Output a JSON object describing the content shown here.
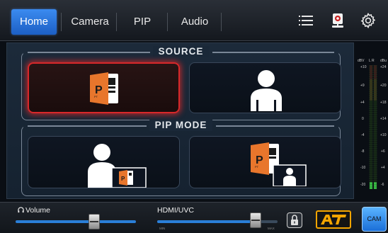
{
  "tabs": [
    {
      "label": "Home",
      "active": true
    },
    {
      "label": "Camera",
      "active": false
    },
    {
      "label": "PIP",
      "active": false
    },
    {
      "label": "Audio",
      "active": false
    }
  ],
  "top_icons": [
    "list-icon",
    "webcam-icon",
    "gear-icon"
  ],
  "source": {
    "title": "SOURCE",
    "cards": [
      {
        "name": "source-powerpoint",
        "icon": "powerpoint-icon",
        "selected": true
      },
      {
        "name": "source-camera-person",
        "icon": "person-icon",
        "selected": false
      }
    ]
  },
  "pip_mode": {
    "title": "PIP MODE",
    "cards": [
      {
        "name": "pip-person-with-slides-inset",
        "icon": "person-with-slides-inset-icon"
      },
      {
        "name": "pip-slides-with-person-inset",
        "icon": "slides-with-person-inset-icon"
      }
    ]
  },
  "meter": {
    "header_left": "dBV",
    "header_mid": "L R",
    "header_right": "dBu",
    "left_scale": [
      "+10",
      "+9",
      "+4",
      "0",
      "-4",
      "-8",
      "-10",
      "-20"
    ],
    "right_scale": [
      "+24",
      "+20",
      "+18",
      "+14",
      "+10",
      "+6",
      "+4",
      "-6"
    ]
  },
  "bottom": {
    "volume_label": "Volume",
    "volume_level": 0.65,
    "hdmi_label": "HDMI/UVC",
    "hdmi_level": 0.82,
    "hdmi_min": "MIN",
    "hdmi_max": "MAX",
    "logo_text": "AT",
    "cam_label": "CAM"
  },
  "colors": {
    "tab_active": "#2f7ee6",
    "selected_border": "#d8282a",
    "powerpoint_orange": "#e8762c",
    "logo_yellow": "#f5a500",
    "cam_button": "#3a96f0"
  }
}
